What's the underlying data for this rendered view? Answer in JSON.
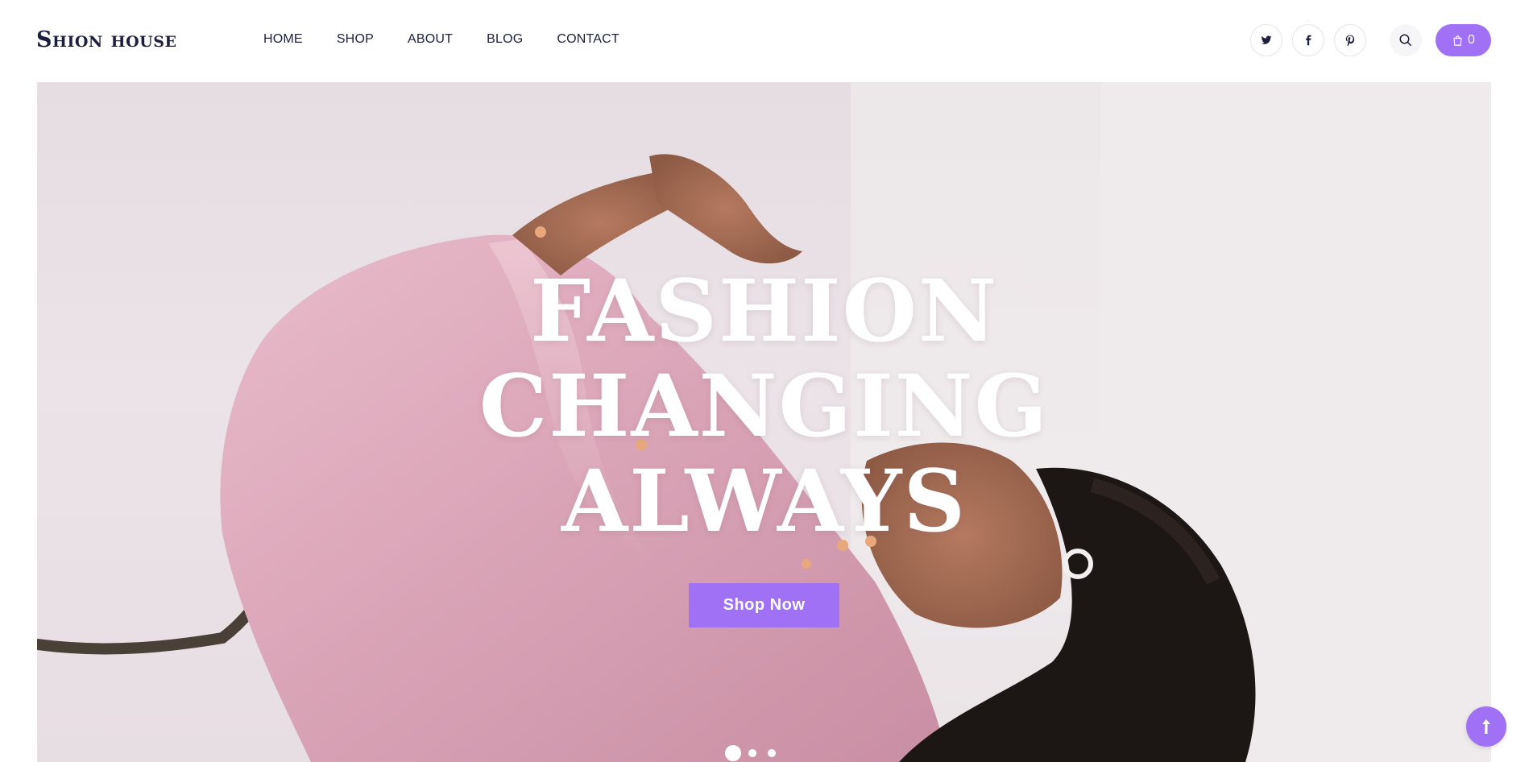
{
  "brand": {
    "logo": "Shion house"
  },
  "nav": {
    "items": [
      {
        "label": "HOME"
      },
      {
        "label": "SHOP"
      },
      {
        "label": "ABOUT"
      },
      {
        "label": "BLOG"
      },
      {
        "label": "CONTACT"
      }
    ]
  },
  "header_actions": {
    "social": [
      {
        "icon": "twitter-icon"
      },
      {
        "icon": "facebook-icon"
      },
      {
        "icon": "pinterest-icon"
      }
    ],
    "search_icon": "search-icon",
    "cart": {
      "icon": "shopping-bag-icon",
      "count": "0"
    }
  },
  "hero": {
    "title_lines": [
      "FASHION",
      "CHANGING",
      "ALWAYS"
    ],
    "cta_label": "Shop Now",
    "slides": 3,
    "active_slide": 1
  },
  "back_to_top_icon": "arrow-up-icon",
  "colors": {
    "accent": "#a070f5",
    "text_dark": "#1d1f3f",
    "hero_text": "#ffffff"
  }
}
